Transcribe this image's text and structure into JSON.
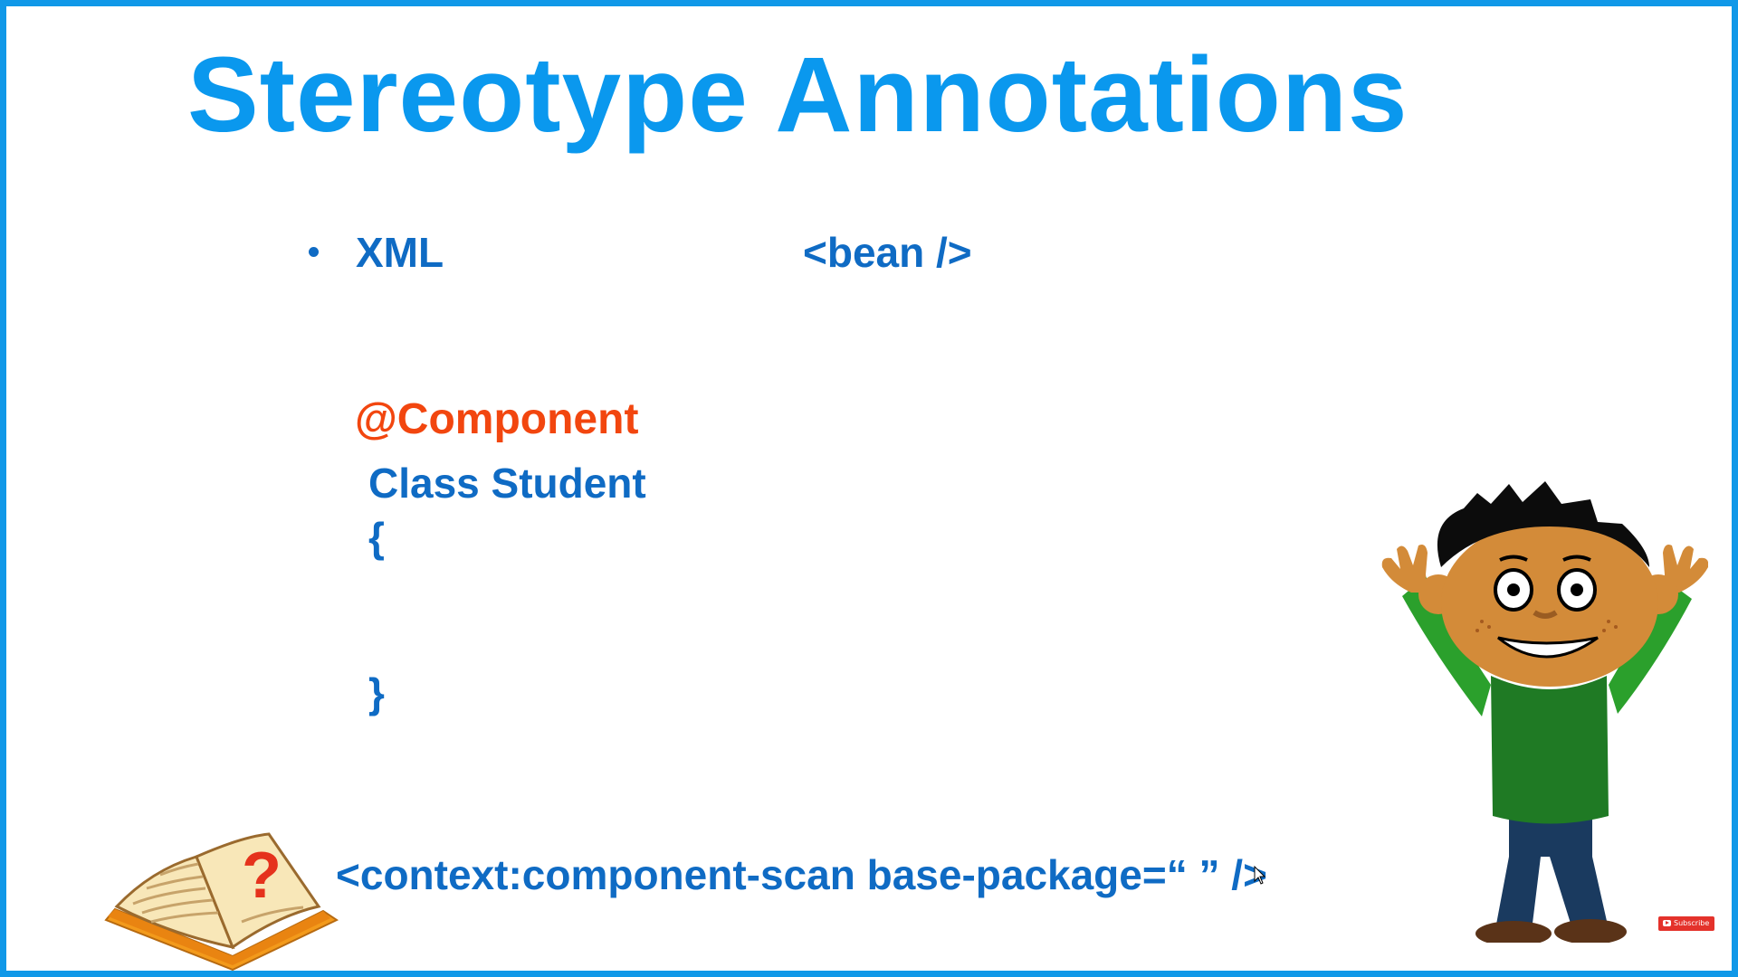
{
  "slide": {
    "title": "Stereotype Annotations",
    "bullet": "XML",
    "bean_tag": "<bean />",
    "annotation": "@Component",
    "class_line": "Class Student",
    "brace_open": "{",
    "brace_close": "}",
    "scan_line": "<context:component-scan base-package=“ ” />"
  },
  "badge": {
    "label": "Subscribe"
  },
  "colors": {
    "title": "#0a98ee",
    "text": "#0f6bc4",
    "annotation": "#f2460f",
    "border": "#1098e8"
  },
  "icons": [
    "question-book-icon",
    "cartoon-boy-illustration",
    "mouse-cursor-icon",
    "youtube-play-icon"
  ]
}
